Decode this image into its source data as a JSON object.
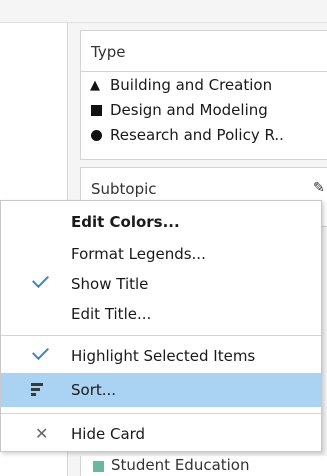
{
  "legend_type": {
    "title": "Type",
    "items": [
      {
        "shape": "triangle",
        "label": "Building and Creation"
      },
      {
        "shape": "square",
        "label": "Design and Modeling"
      },
      {
        "shape": "circle",
        "label": "Research and Policy R.."
      }
    ]
  },
  "legend_subtopic": {
    "title": "Subtopic",
    "visible_item": {
      "label": "Student Education",
      "color": "#6bb6a3"
    }
  },
  "menu": {
    "items": [
      {
        "label": "Edit Colors...",
        "bold": true,
        "checked": false
      },
      {
        "label": "Format Legends...",
        "checked": false
      },
      {
        "label": "Show Title",
        "checked": true
      },
      {
        "label": "Edit Title...",
        "checked": false
      },
      {
        "label": "Highlight Selected Items",
        "checked": true
      },
      {
        "label": "Sort...",
        "highlighted": true,
        "icon": "sort-icon"
      },
      {
        "label": "Hide Card",
        "icon": "close-icon"
      }
    ]
  },
  "colors": {
    "highlight": "#a9d2f3",
    "check": "#3b83c4"
  }
}
